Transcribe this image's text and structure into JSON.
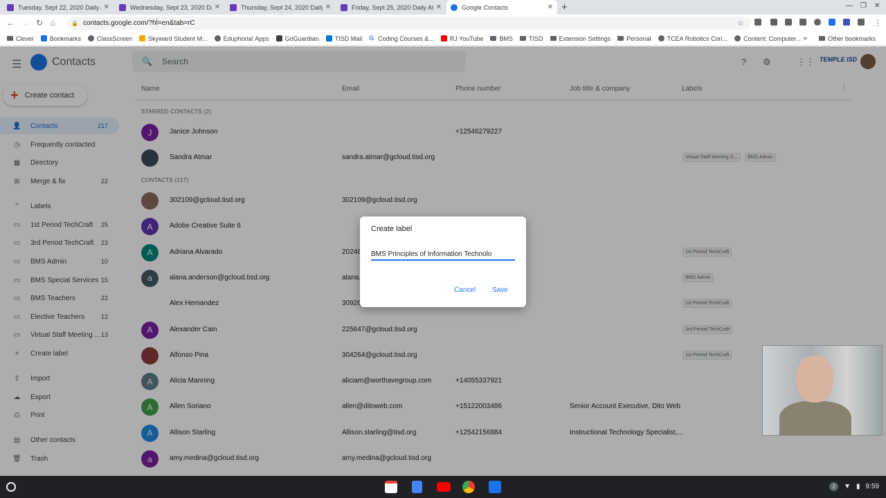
{
  "browser": {
    "tabs": [
      {
        "title": "Tuesday, Sept 22, 2020 Daily At"
      },
      {
        "title": "Wednesday, Sept 23, 2020 Daily"
      },
      {
        "title": "Thursday, Sept 24, 2020 Daily At"
      },
      {
        "title": "Friday, Sept 25, 2020 Daily Atte"
      },
      {
        "title": "Google Contacts"
      }
    ],
    "new_tab_icon": "+",
    "url": "contacts.google.com/?hl=en&tab=rC",
    "bookmarks": [
      {
        "label": "Clever"
      },
      {
        "label": "Bookmarks"
      },
      {
        "label": "ClassScreen"
      },
      {
        "label": "Skyward Student M..."
      },
      {
        "label": "Eduphoria! Apps"
      },
      {
        "label": "GoGuardian"
      },
      {
        "label": "TISD Mail"
      },
      {
        "label": "Coding Courses &..."
      },
      {
        "label": "RJ YouTube"
      },
      {
        "label": "BMS"
      },
      {
        "label": "TISD"
      },
      {
        "label": "Extension Settings"
      },
      {
        "label": "Personal"
      },
      {
        "label": "TCEA Robotics Con..."
      },
      {
        "label": "Content: Computer..."
      }
    ],
    "other_bookmarks": "Other bookmarks",
    "more_chevron": "»"
  },
  "header": {
    "app_title": "Contacts",
    "search_placeholder": "Search",
    "brand": "TEMPLE ISD"
  },
  "sidebar": {
    "create_contact": "Create contact",
    "items": [
      {
        "label": "Contacts",
        "count": "217"
      },
      {
        "label": "Frequently contacted",
        "count": ""
      },
      {
        "label": "Directory",
        "count": ""
      },
      {
        "label": "Merge & fix",
        "count": "22"
      }
    ],
    "labels_header": "Labels",
    "labels": [
      {
        "label": "1st Period TechCraft",
        "count": "25"
      },
      {
        "label": "3rd Period TechCraft",
        "count": "23"
      },
      {
        "label": "BMS Admin",
        "count": "10"
      },
      {
        "label": "BMS Special Services",
        "count": "15"
      },
      {
        "label": "BMS Teachers",
        "count": "22"
      },
      {
        "label": "Elective Teachers",
        "count": "12"
      },
      {
        "label": "Virtual Staff Meeting ...",
        "count": "13"
      }
    ],
    "create_label": "Create label",
    "bottom": [
      {
        "label": "Import"
      },
      {
        "label": "Export"
      },
      {
        "label": "Print"
      },
      {
        "label": "Other contacts"
      },
      {
        "label": "Trash"
      }
    ]
  },
  "table": {
    "columns": [
      "Name",
      "Email",
      "Phone number",
      "Job title & company",
      "Labels"
    ],
    "starred_header": "STARRED CONTACTS (2)",
    "contacts_header": "CONTACTS (217)",
    "starred": [
      {
        "initial": "J",
        "color": "#7b1fa2",
        "name": "Janice Johnson",
        "email": "",
        "phone": "+12546279227",
        "job": "",
        "labels": []
      },
      {
        "initial": "",
        "color": "#3a4a5a",
        "name": "Sandra Atmar",
        "email": "sandra.atmar@gcloud.tisd.org",
        "phone": "",
        "job": "",
        "labels": [
          "Virtual Staff Meeting G...",
          "BMS Admin"
        ]
      }
    ],
    "contacts": [
      {
        "initial": "",
        "color": "#8a6a5a",
        "name": "302109@gcloud.tisd.org",
        "email": "302109@gcloud.tisd.org",
        "phone": "",
        "job": "",
        "labels": []
      },
      {
        "initial": "A",
        "color": "#5e35b1",
        "name": "Adobe Creative Suite 6",
        "email": "",
        "phone": "",
        "job": "",
        "labels": []
      },
      {
        "initial": "A",
        "color": "#00897b",
        "name": "Adriana Alvarado",
        "email": "20248",
        "phone": "",
        "job": "",
        "labels": [
          "1st Period TechCraft"
        ]
      },
      {
        "initial": "a",
        "color": "#455a64",
        "name": "alana.anderson@gcloud.tisd.org",
        "email": "alana.",
        "phone": "",
        "job": "",
        "labels": [
          "BMS Admin"
        ]
      },
      {
        "initial": "",
        "color": "#ffffff",
        "name": "Alex Hernandez",
        "email": "30926",
        "phone": "",
        "job": "",
        "labels": [
          "1st Period TechCraft"
        ]
      },
      {
        "initial": "A",
        "color": "#7b1fa2",
        "name": "Alexander Cain",
        "email": "225647@gcloud.tisd.org",
        "phone": "",
        "job": "",
        "labels": [
          "3rd Period TechCraft"
        ]
      },
      {
        "initial": "",
        "color": "#8d3b3b",
        "name": "Alfonso Pina",
        "email": "304264@gcloud.tisd.org",
        "phone": "",
        "job": "",
        "labels": [
          "1st Period TechCraft"
        ]
      },
      {
        "initial": "A",
        "color": "#607d8b",
        "name": "Alicia Manning",
        "email": "aliciam@worthavegroup.com",
        "phone": "+14055337921",
        "job": "",
        "labels": []
      },
      {
        "initial": "A",
        "color": "#43a047",
        "name": "Allen Soriano",
        "email": "allen@ditoweb.com",
        "phone": "+15122003486",
        "job": "Senior Account Executive, Dito Web",
        "labels": []
      },
      {
        "initial": "A",
        "color": "#1e88e5",
        "name": "Allison Starling",
        "email": "Allison.starling@tisd.org",
        "phone": "+12542156884",
        "job": "Instructional Technology Specialist,...",
        "labels": []
      },
      {
        "initial": "a",
        "color": "#7b1fa2",
        "name": "amy.medina@gcloud.tisd.org",
        "email": "amy.medina@gcloud.tisd.org",
        "phone": "",
        "job": "",
        "labels": []
      }
    ]
  },
  "dialog": {
    "title": "Create label",
    "input_value": "BMS Principles of Information Technolo",
    "cancel": "Cancel",
    "save": "Save"
  },
  "shelf": {
    "notification_count": "2",
    "time": "9:59"
  }
}
